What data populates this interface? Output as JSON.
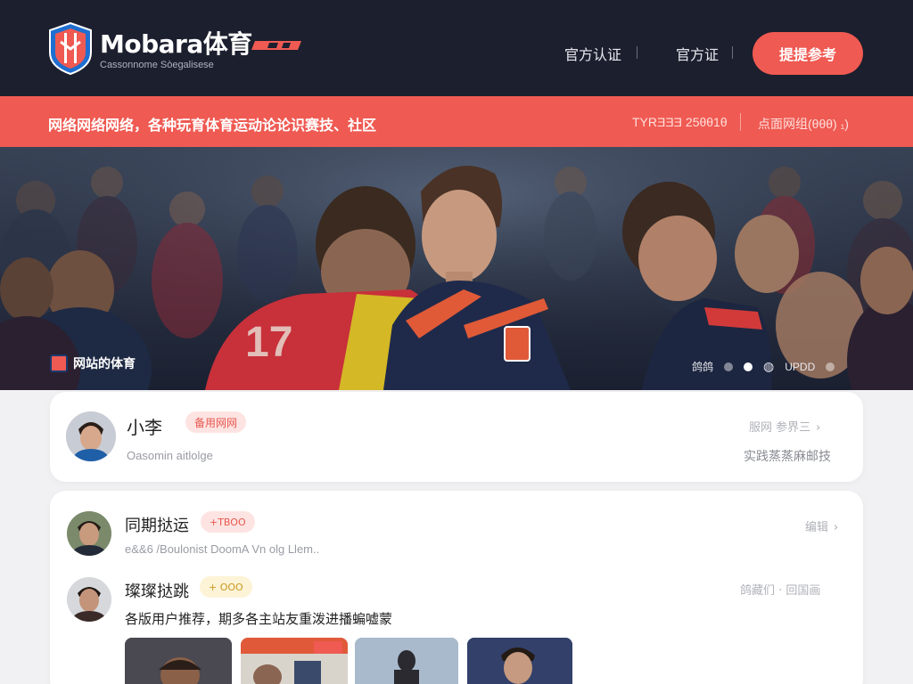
{
  "header": {
    "brand": "Mobara体育",
    "brand_sub": "Cassonnome Sòegalisese",
    "nav": [
      "官方认证",
      "官方证"
    ],
    "cta_label": "提提参考"
  },
  "banner": {
    "text": "网络网络网络，各种玩育体育运动论论识赛技、社区",
    "stat_left": "TYRƎƎƎ  25θθ1θ",
    "stat_right": "点面网组(θθθ)  ₁)"
  },
  "hero": {
    "caption": "网站的体育",
    "carousel_label": "鸽鸽",
    "carousel_count": "UPDD"
  },
  "post_main": {
    "name": "小李",
    "tag": "备用网网",
    "meta": "Oasomin aitlolge",
    "right_top": "服网  参界三",
    "right_bottom": "实践蒸蒸麻邮技"
  },
  "feed": [
    {
      "name": "同期挞运",
      "tag": "+TBOO",
      "tag_color": "red",
      "meta": "e&&6 /Boulonist  DoomA Vn olg   Llem..",
      "right": "编辑"
    },
    {
      "name": "璨璨挞跳",
      "tag": "+ OOO",
      "tag_color": "yellow",
      "right": "鸽藏们  ·  回国画",
      "body": "各版用户推荐，期多各主站友重泼进播蝙嘘蒙"
    }
  ],
  "colors": {
    "header_bg": "#1c1f2e",
    "accent": "#ef5a52",
    "page_bg": "#f1f1f3"
  }
}
